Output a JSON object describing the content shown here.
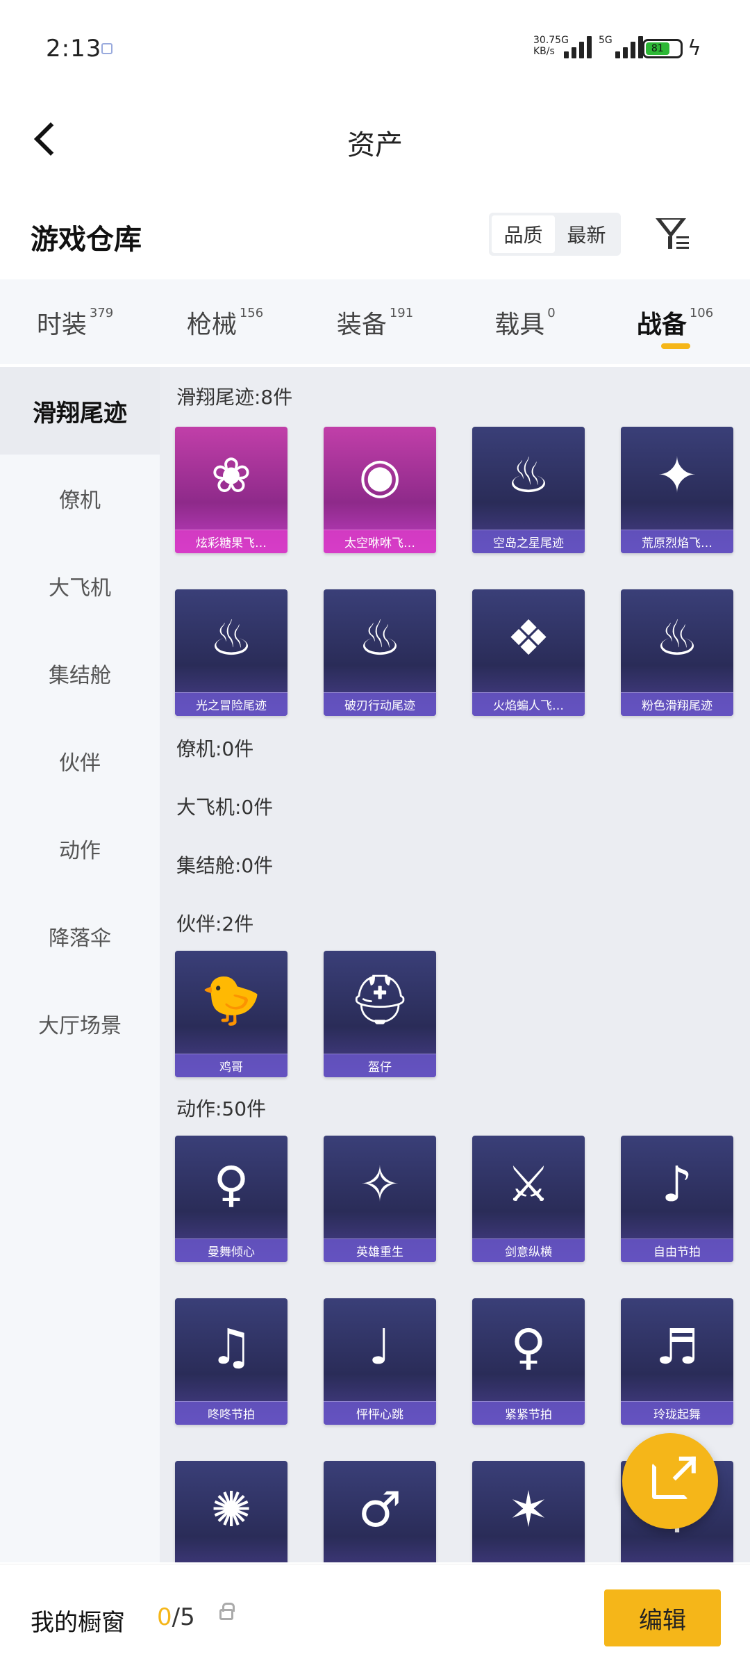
{
  "status_bar": {
    "time": "2:13",
    "network": "30.75G\nKB/s",
    "net_type": "5G",
    "battery": "81"
  },
  "nav": {
    "title": "资产"
  },
  "warehouse": {
    "title": "游戏仓库",
    "sort_options": [
      "品质",
      "最新"
    ]
  },
  "tabs": [
    {
      "label": "时装",
      "count": "379"
    },
    {
      "label": "枪械",
      "count": "156"
    },
    {
      "label": "装备",
      "count": "191"
    },
    {
      "label": "载具",
      "count": "0"
    },
    {
      "label": "战备",
      "count": "106"
    }
  ],
  "sidebar": {
    "items": [
      "滑翔尾迹",
      "僚机",
      "大飞机",
      "集结舱",
      "伙伴",
      "动作",
      "降落伞",
      "大厅场景"
    ]
  },
  "sections": {
    "glide_trail": {
      "title": "滑翔尾迹:8件",
      "items": [
        "炫彩糖果飞…",
        "太空咻咻飞…",
        "空岛之星尾迹",
        "荒原烈焰飞…",
        "光之冒险尾迹",
        "破刃行动尾迹",
        "火焰蝙人飞…",
        "粉色滑翔尾迹"
      ]
    },
    "wingman": {
      "title": "僚机:0件"
    },
    "plane": {
      "title": "大飞机:0件"
    },
    "pod": {
      "title": "集结舱:0件"
    },
    "partner": {
      "title": "伙伴:2件",
      "items": [
        "鸡哥",
        "盔仔"
      ]
    },
    "emote": {
      "title": "动作:50件",
      "items": [
        "曼舞倾心",
        "英雄重生",
        "剑意纵横",
        "自由节拍",
        "咚咚节拍",
        "怦怦心跳",
        "紧紧节拍",
        "玲珑起舞",
        "",
        "",
        "",
        ""
      ]
    }
  },
  "bottom": {
    "showcase_label": "我的橱窗",
    "count_num": "0",
    "count_total": "/5",
    "edit_label": "编辑"
  },
  "colors": {
    "accent": "#f5b619",
    "card": "#2f3266",
    "pink_card": "#b23aa6"
  },
  "icons": {
    "back": "chevron-left-icon",
    "filter": "filter-icon",
    "share": "share-external-icon",
    "lock": "lock-icon"
  }
}
